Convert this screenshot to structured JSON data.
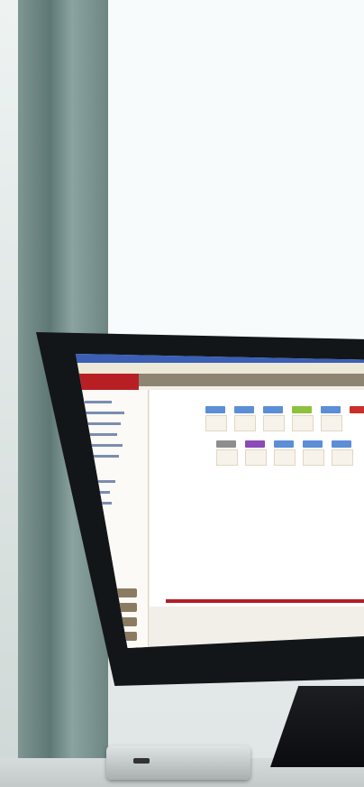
{
  "scene": {
    "subject": "monitor-on-desk-by-window",
    "colors": {
      "frame": "#6e8683",
      "screen_bg": "#f1efe8",
      "accent_red": "#b81f25",
      "titlebar_blue": "#3a5fb5"
    }
  }
}
